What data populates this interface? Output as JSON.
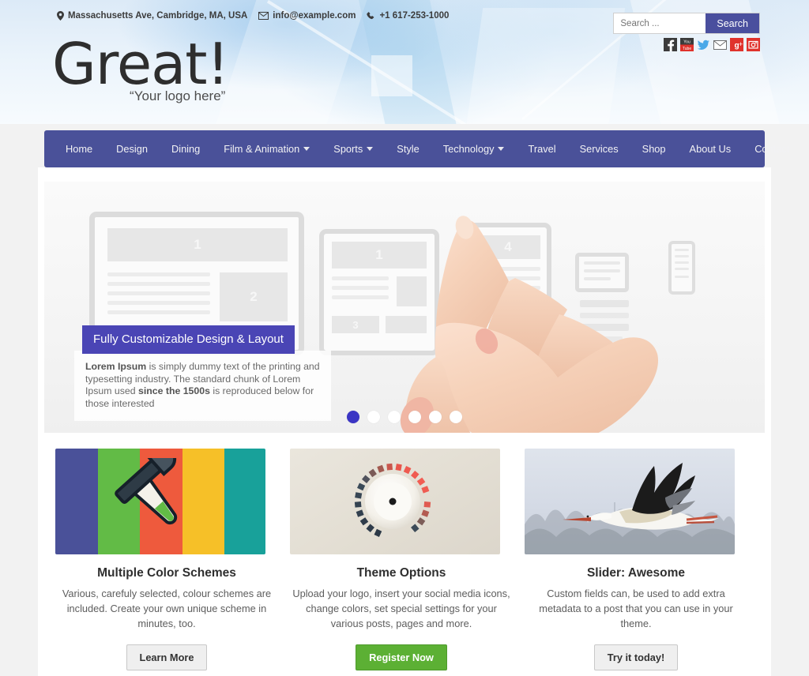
{
  "topbar": {
    "address": "Massachusetts Ave, Cambridge, MA, USA",
    "email": "info@example.com",
    "phone": "+1 617-253-1000",
    "location_icon": "map-pin-icon",
    "email_icon": "envelope-icon",
    "phone_icon": "phone-icon"
  },
  "search": {
    "placeholder": "Search ...",
    "value": "",
    "button_label": "Search",
    "button_color": "#4a4f9e"
  },
  "socials": [
    {
      "name": "facebook-icon",
      "label": "Facebook",
      "color": "#3b3b3b"
    },
    {
      "name": "youtube-icon",
      "label": "YouTube",
      "color": "#e0322c"
    },
    {
      "name": "twitter-icon",
      "label": "Twitter",
      "color": "#4aa8e8"
    },
    {
      "name": "email-icon",
      "label": "Email",
      "color": "#6f6f6f"
    },
    {
      "name": "googleplus-icon",
      "label": "Google Plus",
      "color": "#e0322c"
    },
    {
      "name": "instagram-icon",
      "label": "Instagram",
      "color": "#e0322c"
    }
  ],
  "logo": {
    "title": "Great!",
    "tagline": "“Your logo here”"
  },
  "nav": {
    "background": "#4a5199",
    "items": [
      {
        "label": "Home",
        "dropdown": false
      },
      {
        "label": "Design",
        "dropdown": false
      },
      {
        "label": "Dining",
        "dropdown": false
      },
      {
        "label": "Film & Animation",
        "dropdown": true
      },
      {
        "label": "Sports",
        "dropdown": true
      },
      {
        "label": "Style",
        "dropdown": false
      },
      {
        "label": "Technology",
        "dropdown": true
      },
      {
        "label": "Travel",
        "dropdown": false
      },
      {
        "label": "Services",
        "dropdown": false
      },
      {
        "label": "Shop",
        "dropdown": false
      },
      {
        "label": "About Us",
        "dropdown": false
      },
      {
        "label": "Contact",
        "dropdown": false
      }
    ]
  },
  "slider": {
    "caption_title": "Fully Customizable Design & Layout",
    "caption_title_bg": "#4a45b5",
    "caption_lead": "Lorem Ipsum",
    "caption_mid": " is simply dummy text of the printing and typesetting industry. The standard chunk of Lorem Ipsum used ",
    "caption_bold2": "since the 1500s",
    "caption_end": " is reproduced below for those interested",
    "slide_numbers": [
      "1",
      "2",
      "3",
      "4"
    ],
    "dots_total": 6,
    "dots_active_index": 0,
    "active_dot_color": "#3b35c4",
    "image_alt": "hand pointing at tablet wireframe devices"
  },
  "cards": [
    {
      "title": "Multiple Color Schemes",
      "text": "Various, carefuly selected, colour schemes are included. Create your own unique scheme in minutes, too.",
      "button_label": "Learn More",
      "button_style": "default",
      "image_alt": "eyedropper over color swatches",
      "swatches": [
        "#4a5199",
        "#62bb46",
        "#ee5a3d",
        "#f6c028",
        "#18a19a"
      ]
    },
    {
      "title": "Theme Options",
      "text": "Upload your logo, insert your social media icons, change colors, set special settings for your various posts, pages and more.",
      "button_label": "Register Now",
      "button_style": "green",
      "image_alt": "control dial knob with colored tick marks"
    },
    {
      "title": "Slider: Awesome",
      "text": "Custom fields can, be used to add extra metadata to a post that you can use in your theme.",
      "button_label": "Try it today!",
      "button_style": "default",
      "image_alt": "white stork flying over treeline"
    }
  ]
}
